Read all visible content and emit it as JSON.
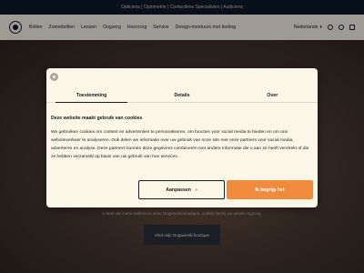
{
  "topbar": {
    "text": "Opticiens | Optometrie | Contactlens Specialisten | Audiciens"
  },
  "nav": {
    "items": [
      "Brillen",
      "Zonnebrillen",
      "Lenzen",
      "Oogzorg",
      "Hoorzorg",
      "Service",
      "Design-montuurs met korting"
    ],
    "language": "Nederlands",
    "icons": [
      "search-icon",
      "user-icon",
      "store-icon"
    ]
  },
  "hero": {
    "text": "U bent van harte welkom in onze Oogwereld boutique, ontdek hierbij uw eerste oogzorg.",
    "button_label": "Vind mijn Oogwereld boutique"
  },
  "cookie_dialog": {
    "tabs": [
      "Toestemming",
      "Details",
      "Over"
    ],
    "active_tab": "Toestemming",
    "heading": "Deze website maakt gebruik van cookies",
    "body": "We gebruiken cookies om content en advertenties te personaliseren, om functies voor social media te bieden en om ons websiteverkeer te analyseren. Ook delen we informatie over uw gebruik van onze site met onze partners voor social media, adverteren en analyse. Deze partners kunnen deze gegevens combineren met andere informatie die u aan ze heeft verstrekt of die ze hebben verzameld op basis van uw gebruik van hun services.",
    "customize_label": "Aanpassen",
    "accept_label": "Ik begrijp het"
  },
  "colors": {
    "accent": "#f08a3c",
    "navy": "#0d1b2a",
    "dialog_bg": "#fbf7e8"
  }
}
